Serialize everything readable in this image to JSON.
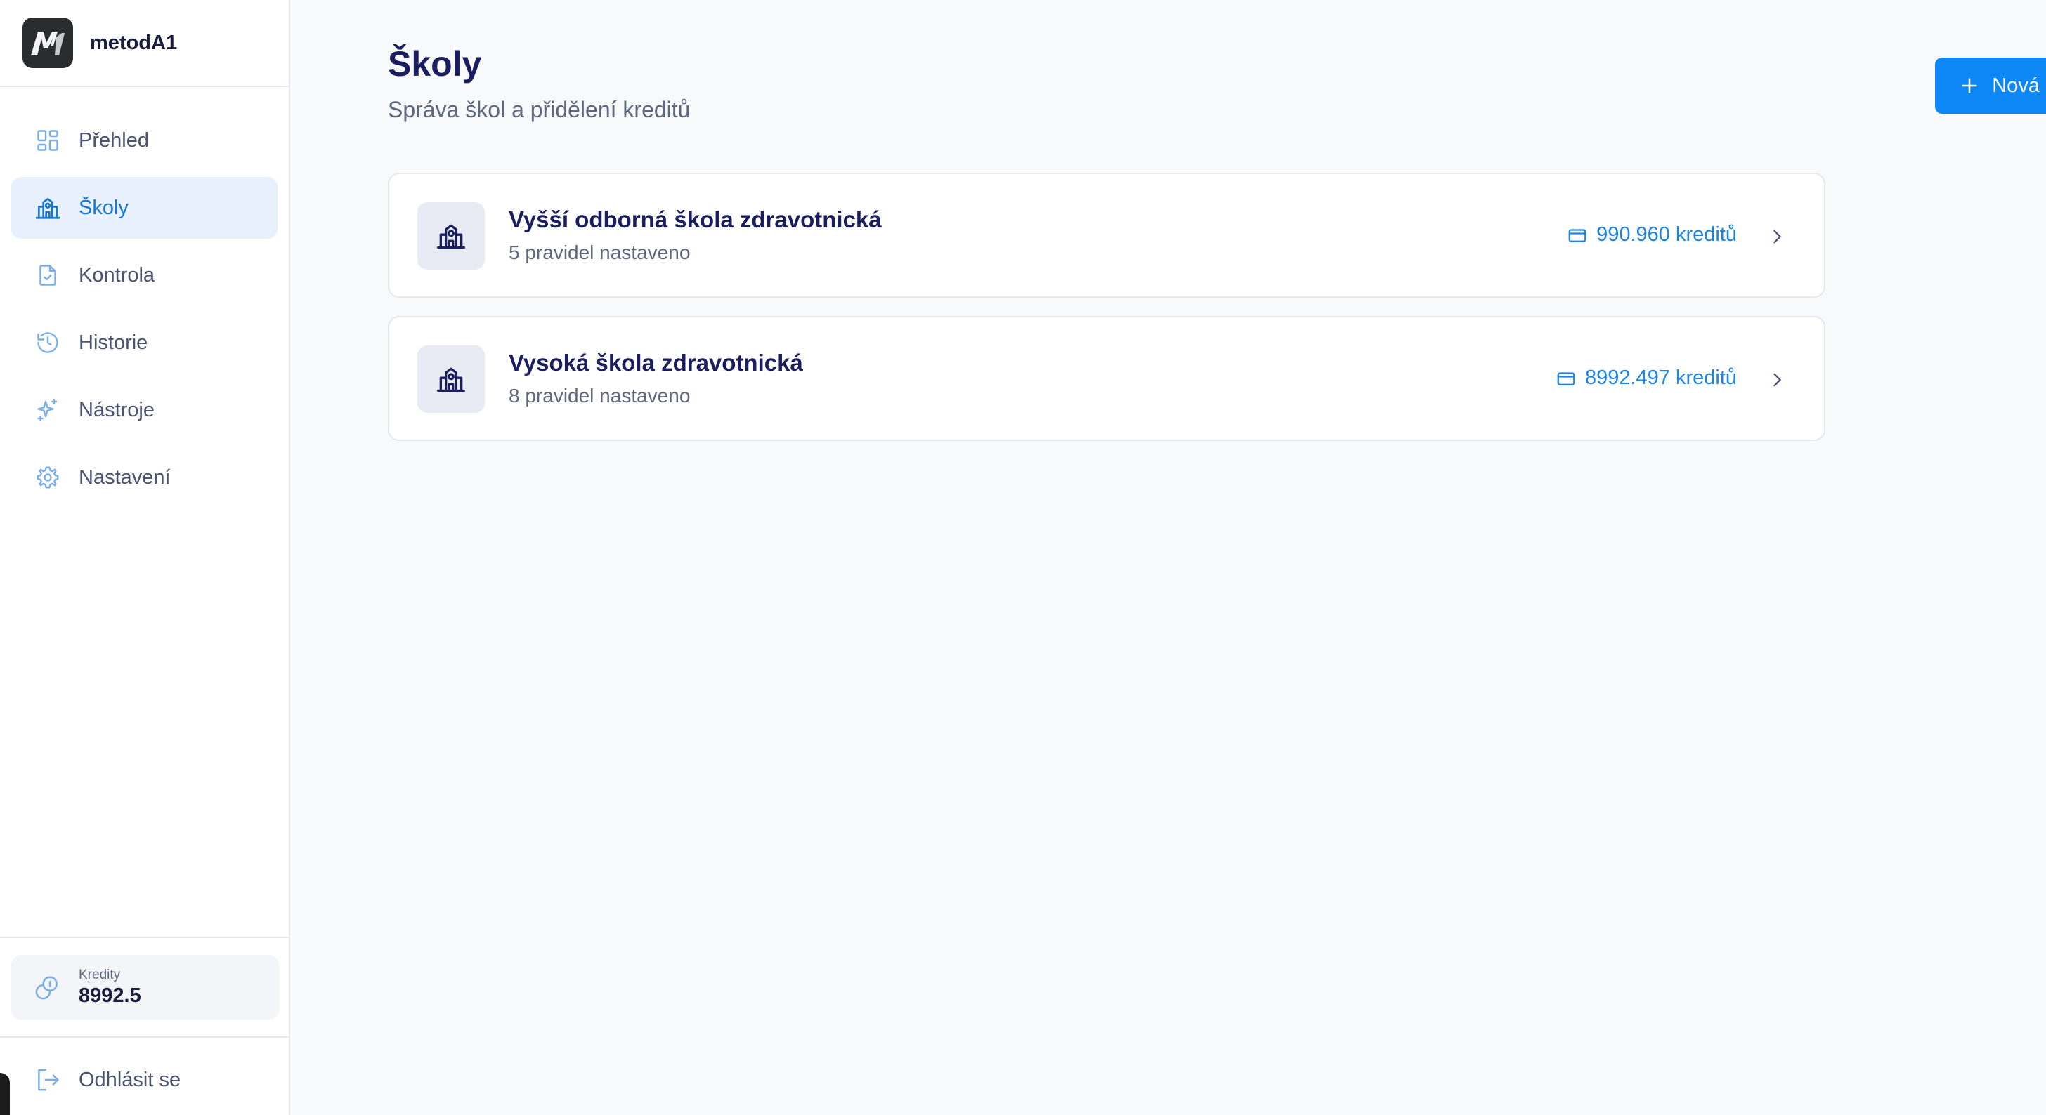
{
  "brand": {
    "logo_text": "M1",
    "name": "metodA1"
  },
  "sidebar": {
    "items": [
      {
        "label": "Přehled",
        "icon": "grid-icon",
        "active": false
      },
      {
        "label": "Školy",
        "icon": "school-icon",
        "active": true
      },
      {
        "label": "Kontrola",
        "icon": "file-check-icon",
        "active": false
      },
      {
        "label": "Historie",
        "icon": "history-icon",
        "active": false
      },
      {
        "label": "Nástroje",
        "icon": "sparkles-icon",
        "active": false
      },
      {
        "label": "Nastavení",
        "icon": "gear-icon",
        "active": false
      }
    ],
    "credits": {
      "label": "Kredity",
      "value": "8992.5",
      "icon": "coins-icon"
    },
    "logout": {
      "label": "Odhlásit se",
      "icon": "logout-icon"
    }
  },
  "main": {
    "title": "Školy",
    "subtitle": "Správa škol a přidělení kreditů",
    "new_button_label": "Nová škola",
    "schools": [
      {
        "name": "Vyšší odborná škola zdravotnická",
        "rules": "5 pravidel nastaveno",
        "credits": "990.960 kreditů"
      },
      {
        "name": "Vysoká škola zdravotnická",
        "rules": "8 pravidel nastaveno",
        "credits": "8992.497 kreditů"
      }
    ]
  },
  "colors": {
    "accent": "#0d87f5",
    "active_bg": "#e7f0fc",
    "active_text": "#1577d6",
    "title": "#1a1d5e"
  }
}
